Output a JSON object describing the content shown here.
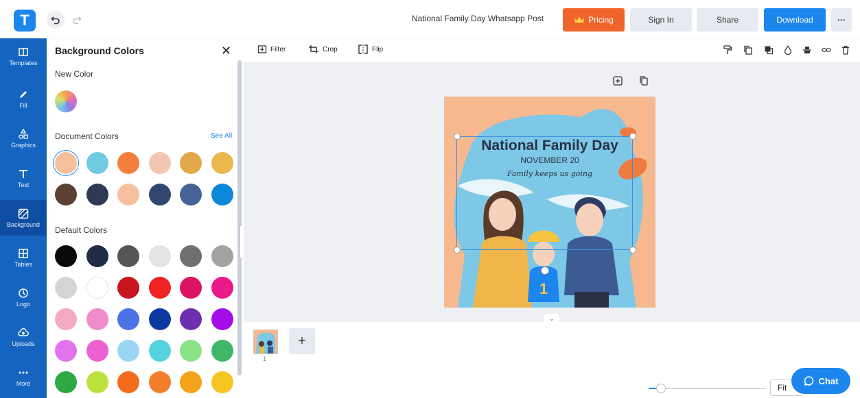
{
  "header": {
    "logo_letter": "T",
    "document_title": "National Family Day Whatsapp Post",
    "pricing_label": "Pricing",
    "signin_label": "Sign In",
    "share_label": "Share",
    "download_label": "Download",
    "more_label": "···"
  },
  "nav": {
    "items": [
      {
        "label": "Templates",
        "icon": "templates-icon"
      },
      {
        "label": "Fill",
        "icon": "pen-icon"
      },
      {
        "label": "Graphics",
        "icon": "shapes-icon"
      },
      {
        "label": "Text",
        "icon": "text-icon"
      },
      {
        "label": "Background",
        "icon": "background-icon"
      },
      {
        "label": "Tables",
        "icon": "table-icon"
      },
      {
        "label": "Logo",
        "icon": "logo-icon"
      },
      {
        "label": "Uploads",
        "icon": "cloud-upload-icon"
      },
      {
        "label": "More",
        "icon": "more-icon"
      }
    ],
    "active": "Background"
  },
  "panel": {
    "title": "Background Colors",
    "close": "✕",
    "new_color_label": "New Color",
    "document_colors_label": "Document Colors",
    "see_all": "See All",
    "default_colors_label": "Default Colors",
    "document_colors": [
      "#f6c09c",
      "#6fcbe0",
      "#f47f3c",
      "#f4c6b1",
      "#e2a84a",
      "#ebb84e",
      "#5b4033",
      "#2e3954",
      "#f6bf9e",
      "#304772",
      "#466398",
      "#0d87d8"
    ],
    "default_colors": [
      "#0a0a0a",
      "#202b45",
      "#555555",
      "#e3e3e3",
      "#6f6f6f",
      "#a3a3a3",
      "#d4d4d4",
      "#ffffff",
      "#c8141c",
      "#ef2323",
      "#dc1364",
      "#ea1a8a",
      "#f4a9c4",
      "#f08acb",
      "#4b73e6",
      "#0c3aa3",
      "#6d2fae",
      "#a30ee8",
      "#e173ec",
      "#ee5fcf",
      "#9bd5f5",
      "#55d3df",
      "#8be388",
      "#3fb768",
      "#2da842",
      "#bde23e",
      "#f26b1d",
      "#f47f2b",
      "#f4a21a",
      "#f5c521"
    ]
  },
  "toolbar": {
    "filter_label": "Filter",
    "crop_label": "Crop",
    "flip_label": "Flip"
  },
  "design": {
    "title": "National Family Day",
    "date": "NOVEMBER 20",
    "tagline": "Family keeps us going"
  },
  "pages": {
    "page_number": "1",
    "add_label": "+"
  },
  "zoom": {
    "fit_label": "Fit",
    "level_fraction": 0.1
  },
  "chat": {
    "label": "Chat"
  }
}
